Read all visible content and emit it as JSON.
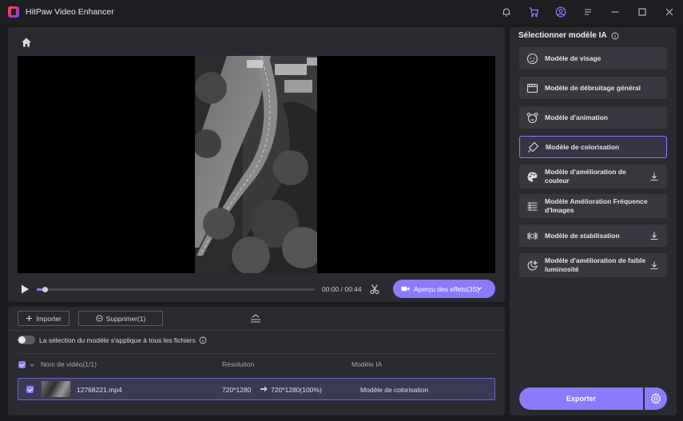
{
  "app": {
    "title": "HitPaw Video Enhancer"
  },
  "titlebar": {
    "icons": [
      "bell-icon",
      "cart-icon",
      "account-icon",
      "menu-icon",
      "minimize-icon",
      "maximize-icon",
      "close-icon"
    ]
  },
  "player": {
    "time": "00:00 / 00:44",
    "preview_label": "Aperçu des effets(3S)",
    "progress": 0.02
  },
  "files": {
    "import_label": "Importer",
    "delete_label": "Supprimer(1)",
    "apply_all_label": "La sélection du modèle s'applique à tous les fichiers",
    "columns": {
      "name": "Nom de vidéo(1/1)",
      "resolution": "Résolution",
      "model": "Modèle IA"
    },
    "rows": [
      {
        "name": "12768221.mp4",
        "res_from": "720*1280",
        "res_to": "720*1280(100%)",
        "model": "Modèle de colorisation"
      }
    ]
  },
  "sidebar": {
    "title": "Sélectionner modèle IA",
    "models": [
      {
        "label": "Modèle de visage",
        "icon": "face-icon",
        "download": false
      },
      {
        "label": "Modèle de débruitage général",
        "icon": "denoise-icon",
        "download": false
      },
      {
        "label": "Modèle d'animation",
        "icon": "animation-icon",
        "download": false
      },
      {
        "label": "Modèle de colorisation",
        "icon": "colorize-icon",
        "download": false,
        "selected": true
      },
      {
        "label": "Modèle d'amélioration de couleur",
        "icon": "palette-icon",
        "download": true
      },
      {
        "label": "Modèle Amélioration Fréquence d'Images",
        "icon": "frame-rate-icon",
        "download": false
      },
      {
        "label": "Modèle de stabilisation",
        "icon": "stabilize-icon",
        "download": true
      },
      {
        "label": "Modèle d'amélioration de faible luminosité",
        "icon": "low-light-icon",
        "download": true
      }
    ],
    "export_label": "Exporter"
  },
  "colors": {
    "accent": "#8c7bff",
    "panel": "#2a2b31",
    "background": "#1a1b1f"
  }
}
